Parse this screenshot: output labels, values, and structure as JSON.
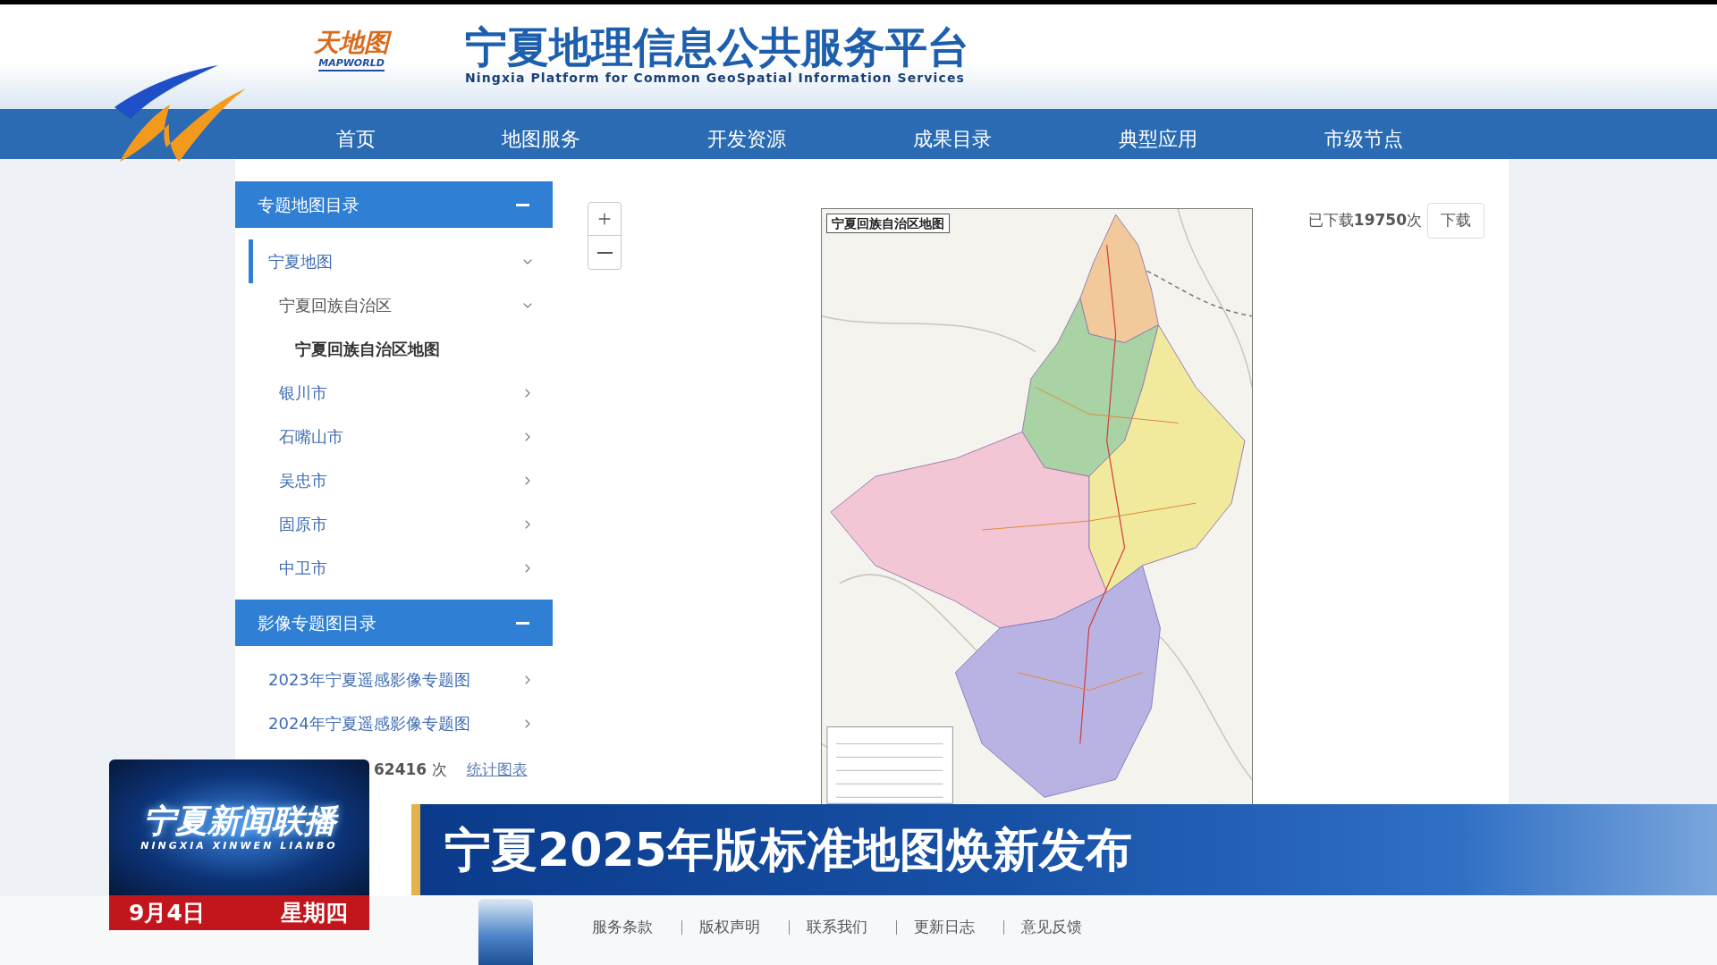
{
  "header": {
    "logo_name": "天地图",
    "logo_latin": "MAPWORLD",
    "title": "宁夏地理信息公共服务平台",
    "subtitle": "Ningxia Platform for Common GeoSpatial Information Services"
  },
  "nav": [
    {
      "label": "首页"
    },
    {
      "label": "地图服务"
    },
    {
      "label": "开发资源"
    },
    {
      "label": "成果目录"
    },
    {
      "label": "典型应用"
    },
    {
      "label": "市级节点"
    }
  ],
  "sidebar": {
    "sections": [
      {
        "title": "专题地图目录",
        "expanded": true,
        "items": [
          {
            "label": "宁夏地图",
            "active": true,
            "selected": false,
            "expanded": true,
            "children": [
              {
                "label": "宁夏回族自治区",
                "selected": false,
                "expanded": true,
                "children": [
                  {
                    "label": "宁夏回族自治区地图",
                    "selected": true
                  }
                ]
              },
              {
                "label": "银川市",
                "selected": false,
                "expanded": false
              },
              {
                "label": "石嘴山市",
                "selected": false,
                "expanded": false
              },
              {
                "label": "吴忠市",
                "selected": false,
                "expanded": false
              },
              {
                "label": "固原市",
                "selected": false,
                "expanded": false
              },
              {
                "label": "中卫市",
                "selected": false,
                "expanded": false
              }
            ]
          }
        ]
      },
      {
        "title": "影像专题图目录",
        "expanded": true,
        "items": [
          {
            "label": "2023年宁夏遥感影像专题图",
            "active": false,
            "selected": false,
            "expanded": false
          },
          {
            "label": "2024年宁夏遥感影像专题图",
            "active": false,
            "selected": false,
            "expanded": false
          }
        ]
      }
    ],
    "stats": {
      "count": "**62416** 次",
      "link": "统计图表"
    }
  },
  "map": {
    "title": "宁夏回族自治区地图"
  },
  "download": {
    "count": "已下载**19750**次",
    "button": "下载"
  },
  "footer": {
    "links": [
      "服务条款",
      "版权声明",
      "联系我们",
      "更新日志",
      "意见反馈"
    ]
  },
  "broadcast": {
    "program": "宁夏新闻联播",
    "program_latin": "NINGXIA XINWEN LIANBO",
    "date": "9月4日",
    "weekday": "星期四",
    "headline": "宁夏2025年版标准地图焕新发布"
  }
}
